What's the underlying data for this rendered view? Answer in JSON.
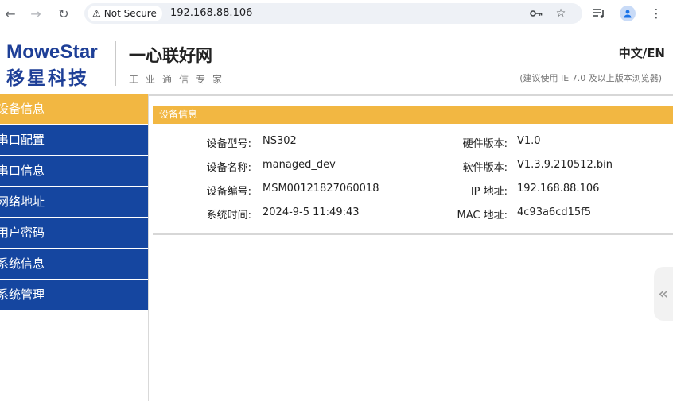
{
  "browser": {
    "security_label": "Not Secure",
    "url": "192.168.88.106"
  },
  "site": {
    "logo_en": "MoweStar",
    "logo_cn": "移星科技",
    "title": "一心联好网",
    "slogan": "工业通信专家",
    "lang_cn": "中文",
    "lang_sep": "/",
    "lang_en": "EN",
    "browser_note": "(建议使用 IE 7.0 及以上版本浏览器)"
  },
  "sidebar": {
    "items": [
      {
        "label": "设备信息",
        "active": true
      },
      {
        "label": "串口配置",
        "active": false
      },
      {
        "label": "串口信息",
        "active": false
      },
      {
        "label": "网络地址",
        "active": false
      },
      {
        "label": "用户密码",
        "active": false
      },
      {
        "label": "系统信息",
        "active": false
      },
      {
        "label": "系统管理",
        "active": false
      }
    ]
  },
  "panel": {
    "title": "设备信息",
    "rows": [
      {
        "l_label": "设备型号:",
        "l_value": "NS302",
        "r_label": "硬件版本:",
        "r_value": "V1.0"
      },
      {
        "l_label": "设备名称:",
        "l_value": "managed_dev",
        "r_label": "软件版本:",
        "r_value": "V1.3.9.210512.bin"
      },
      {
        "l_label": "设备编号:",
        "l_value": "MSM00121827060018",
        "r_label": "IP 地址:",
        "r_value": "192.168.88.106"
      },
      {
        "l_label": "系统时间:",
        "l_value": "2024-9-5 11:49:43",
        "r_label": "MAC 地址:",
        "r_value": "4c93a6cd15f5"
      }
    ]
  },
  "icons": {
    "back": "arrow-left-icon",
    "forward": "arrow-right-icon",
    "reload": "reload-icon",
    "warning": "warning-triangle-icon",
    "key": "key-icon",
    "bookmark": "star-icon",
    "media": "media-queue-icon",
    "profile": "profile-icon",
    "menu": "kebab-menu-icon",
    "collapse": "chevron-left-icon"
  },
  "colors": {
    "brand_blue": "#1e3f97",
    "menu_blue": "#1546a0",
    "accent_orange": "#f2b742"
  }
}
